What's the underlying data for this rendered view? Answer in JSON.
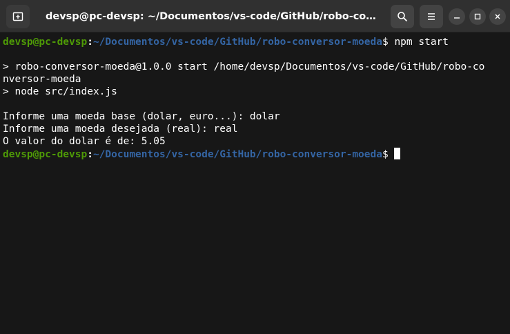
{
  "window": {
    "title": "devsp@pc-devsp: ~/Documentos/vs-code/GitHub/robo-conversor-..."
  },
  "titlebar": {
    "new_tab_icon": "new-tab-icon",
    "search_icon": "search-icon",
    "menu_icon": "hamburger-menu-icon",
    "minimize_icon": "minimize-icon",
    "maximize_icon": "maximize-icon",
    "close_icon": "close-icon"
  },
  "terminal": {
    "prompt": {
      "user_host": "devsp@pc-devsp",
      "separator": ":",
      "path": "~/Documentos/vs-code/GitHub/robo-conversor-moeda",
      "symbol": "$ "
    },
    "command": "npm start",
    "output": {
      "npm_line_1": "> robo-conversor-moeda@1.0.0 start /home/devsp/Documentos/vs-code/GitHub/robo-co",
      "npm_line_2": "nversor-moeda",
      "npm_line_3": "> node src/index.js",
      "blank": "",
      "q1": "Informe uma moeda base (dolar, euro...): dolar",
      "q2": "Informe uma moeda desejada (real): real",
      "result": "O valor do dolar é de: 5.05"
    }
  },
  "colors": {
    "background": "#171717",
    "titlebar": "#303030",
    "user_host": "#4e9a06",
    "path": "#3465a4",
    "text": "#ffffff"
  }
}
